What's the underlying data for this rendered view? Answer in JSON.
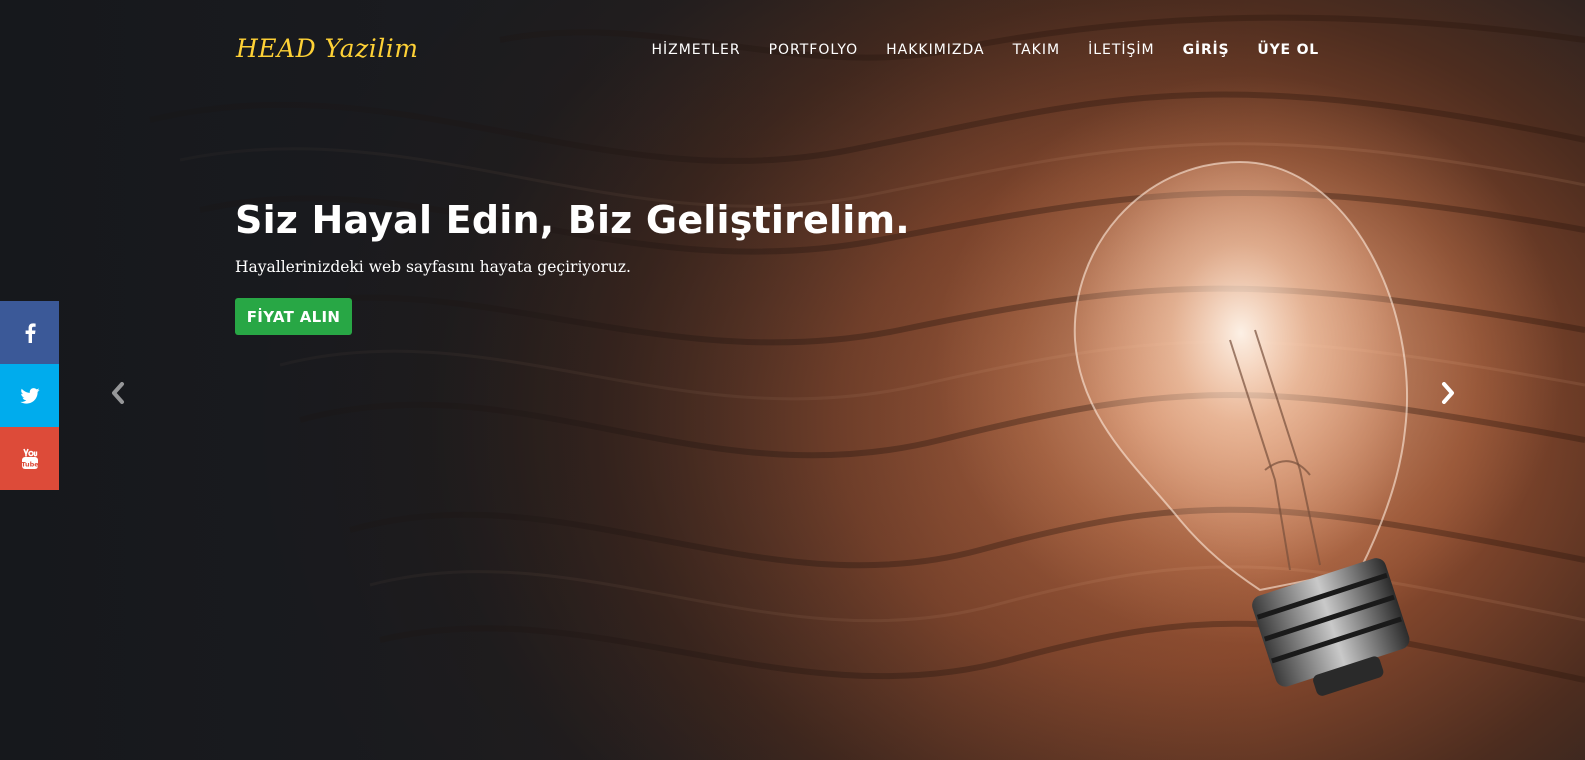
{
  "brand": {
    "name": "HEAD Yazilim",
    "color": "#fed136"
  },
  "nav": {
    "items": [
      {
        "label": "HİZMETLER"
      },
      {
        "label": "PORTFOLYO"
      },
      {
        "label": "HAKKIMIZDA"
      },
      {
        "label": "TAKIM"
      },
      {
        "label": "İLETİŞİM"
      },
      {
        "label": "GİRİŞ"
      },
      {
        "label": "ÜYE OL"
      }
    ]
  },
  "hero": {
    "headline": "Siz Hayal Edin, Biz Geliştirelim.",
    "subline": "Hayallerinizdeki web sayfasını hayata geçiriyoruz.",
    "cta_label": "FİYAT ALIN",
    "cta_color": "#28a745"
  },
  "carousel": {
    "prev_icon": "chevron-left-icon",
    "next_icon": "chevron-right-icon"
  },
  "social": {
    "items": [
      {
        "icon": "facebook-icon",
        "color": "#3b5998"
      },
      {
        "icon": "twitter-icon",
        "color": "#00aced"
      },
      {
        "icon": "youtube-icon",
        "color": "#dd4b39"
      }
    ]
  }
}
